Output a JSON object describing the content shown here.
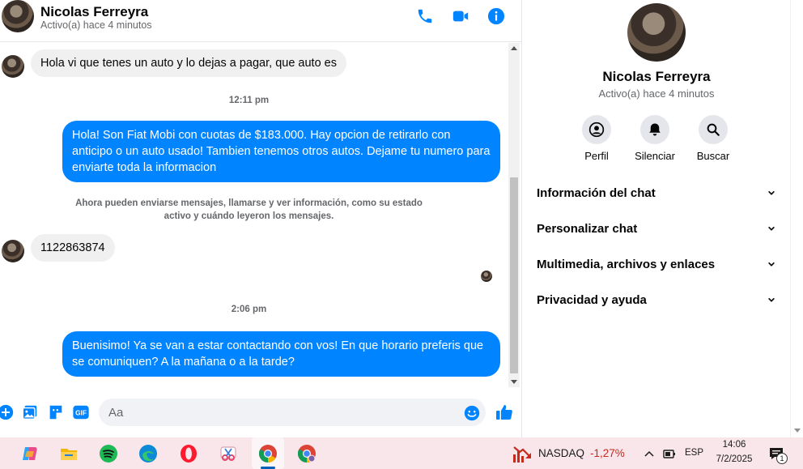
{
  "contact": {
    "name": "Nicolas Ferreyra",
    "status": "Activo(a) hace 4 minutos"
  },
  "messages": [
    {
      "kind": "in",
      "text": "Hola vi que tenes un auto y lo dejas a pagar, que auto es"
    },
    {
      "kind": "time",
      "text": "12:11 pm"
    },
    {
      "kind": "out",
      "text": "Hola! Son Fiat Mobi con cuotas de $183.000. Hay opcion de retirarlo con anticipo o un auto usado! Tambien tenemos otros autos. Dejame tu numero para enviarte toda la informacion"
    },
    {
      "kind": "notice",
      "text": "Ahora pueden enviarse mensajes, llamarse y ver información, como su estado activo y cuándo leyeron los mensajes."
    },
    {
      "kind": "in",
      "text": "1122863874"
    },
    {
      "kind": "time",
      "text": "2:06 pm"
    },
    {
      "kind": "out",
      "text": "Buenisimo! Ya se van a estar contactando con vos! En que horario preferis que se comuniquen? A la mañana o a la tarde?"
    }
  ],
  "composer": {
    "placeholder": "Aa"
  },
  "side_panel": {
    "actions": [
      {
        "label": "Perfil",
        "icon": "profile-icon"
      },
      {
        "label": "Silenciar",
        "icon": "bell-icon"
      },
      {
        "label": "Buscar",
        "icon": "search-icon"
      }
    ],
    "sections": [
      "Información del chat",
      "Personalizar chat",
      "Multimedia, archivos y enlaces",
      "Privacidad y ayuda"
    ]
  },
  "taskbar": {
    "apps": [
      "copilot-icon",
      "file-explorer-icon",
      "spotify-icon",
      "edge-icon",
      "opera-icon",
      "snipping-tool-icon",
      "chrome-icon",
      "chrome-profile-icon"
    ],
    "stock": {
      "name": "NASDAQ",
      "change": "-1,27%"
    },
    "language": "ESP",
    "time": "14:06",
    "date": "7/2/2025",
    "notifications": "1"
  },
  "colors": {
    "accent": "#0084ff",
    "incoming_bubble": "#f0f0f0",
    "stock_negative": "#c42b1c",
    "taskbar": "#f8e6ea"
  }
}
